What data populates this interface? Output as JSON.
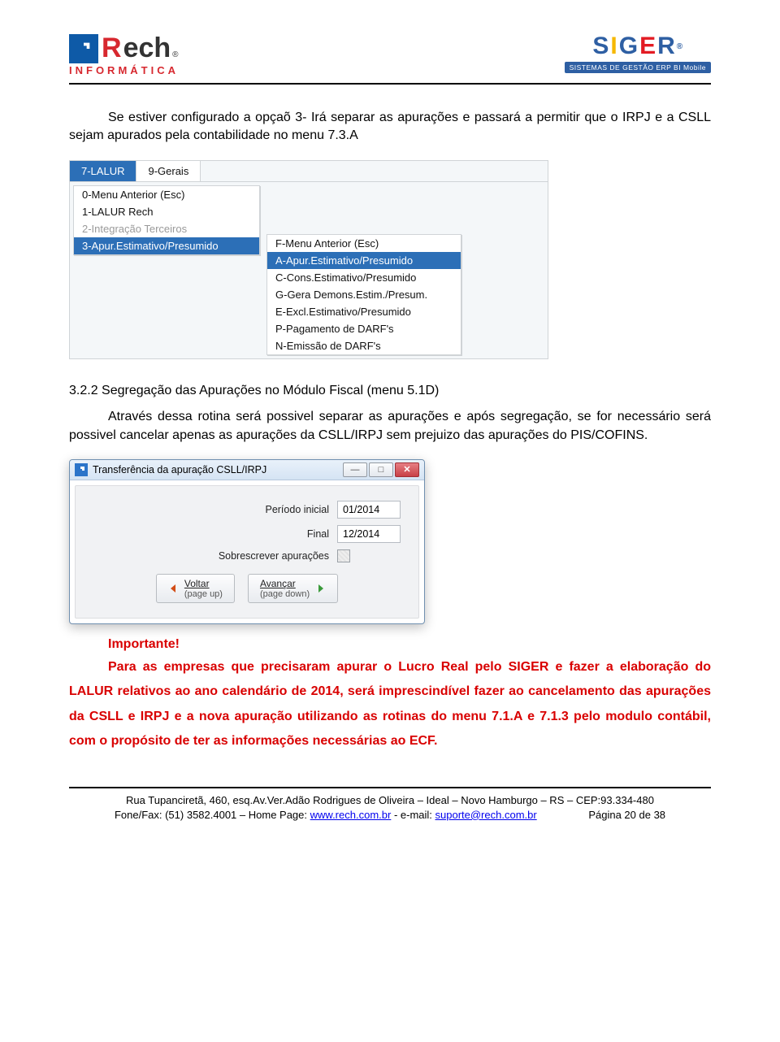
{
  "logos": {
    "rech": {
      "main": "Rech",
      "sub": "INFORMÁTICA",
      "reg": "®"
    },
    "siger": {
      "letters": [
        "S",
        "I",
        "G",
        "E",
        "R"
      ],
      "reg": "®",
      "tag": "SISTEMAS DE GESTÃO  ERP  BI  Mobile"
    }
  },
  "para1": "Se estiver configurado a opçaõ 3- Irá separar as apurações e passará a permitir que o IRPJ e a CSLL sejam apurados pela contabilidade no menu 7.3.A",
  "menu": {
    "tabs": {
      "active": "7-LALUR",
      "other": "9-Gerais"
    },
    "left": [
      {
        "label": "0-Menu Anterior (Esc)"
      },
      {
        "label": "1-LALUR Rech"
      },
      {
        "label": "2-Integração Terceiros",
        "disabled": true
      },
      {
        "label": "3-Apur.Estimativo/Presumido",
        "selected": true
      }
    ],
    "right": [
      {
        "label": "F-Menu Anterior (Esc)"
      },
      {
        "label": "A-Apur.Estimativo/Presumido",
        "selected": true
      },
      {
        "label": "C-Cons.Estimativo/Presumido"
      },
      {
        "label": "G-Gera Demons.Estim./Presum."
      },
      {
        "label": "E-Excl.Estimativo/Presumido"
      },
      {
        "label": "P-Pagamento de DARF's"
      },
      {
        "label": "N-Emissão de DARF's"
      }
    ]
  },
  "heading2": "3.2.2 Segregação das Apurações no Módulo Fiscal (menu 5.1D)",
  "para2": "Através dessa rotina será possivel separar as apurações e após segregação, se for necessário será possivel cancelar apenas as apurações da CSLL/IRPJ sem prejuizo das apurações do PIS/COFINS.",
  "dialog": {
    "title": "Transferência da apuração CSLL/IRPJ",
    "fields": {
      "periodo_inicial": {
        "label": "Período inicial",
        "value": "01/2014"
      },
      "final": {
        "label": "Final",
        "value": "12/2014"
      },
      "sobrescrever": {
        "label": "Sobrescrever apurações"
      }
    },
    "actions": {
      "voltar": {
        "label": "Voltar",
        "sub": "(page up)"
      },
      "avancar": {
        "label": "Avançar",
        "sub": "(page down)"
      }
    }
  },
  "note": {
    "title": "Importante!",
    "body": "Para as empresas que precisaram apurar o Lucro Real pelo SIGER e fazer a elaboração do LALUR relativos ao ano calendário de 2014, será imprescindível fazer ao cancelamento das apurações da CSLL e IRPJ e a nova apuração utilizando as rotinas do menu 7.1.A e 7.1.3 pelo modulo contábil, com o propósito de ter as informações necessárias ao ECF."
  },
  "footer": {
    "line1_a": "Rua Tupanciretã, 460, esq.Av.Ver.Adão Rodrigues de Oliveira – Ideal   –   Novo Hamburgo  –  RS  –  CEP:93.334-480",
    "line2_a": "Fone/Fax: (51) 3582.4001 – Home Page: ",
    "link1": "www.rech.com.br",
    "line2_b": " - e-mail: ",
    "link2": "suporte@rech.com.br",
    "page": "Página 20 de 38"
  }
}
